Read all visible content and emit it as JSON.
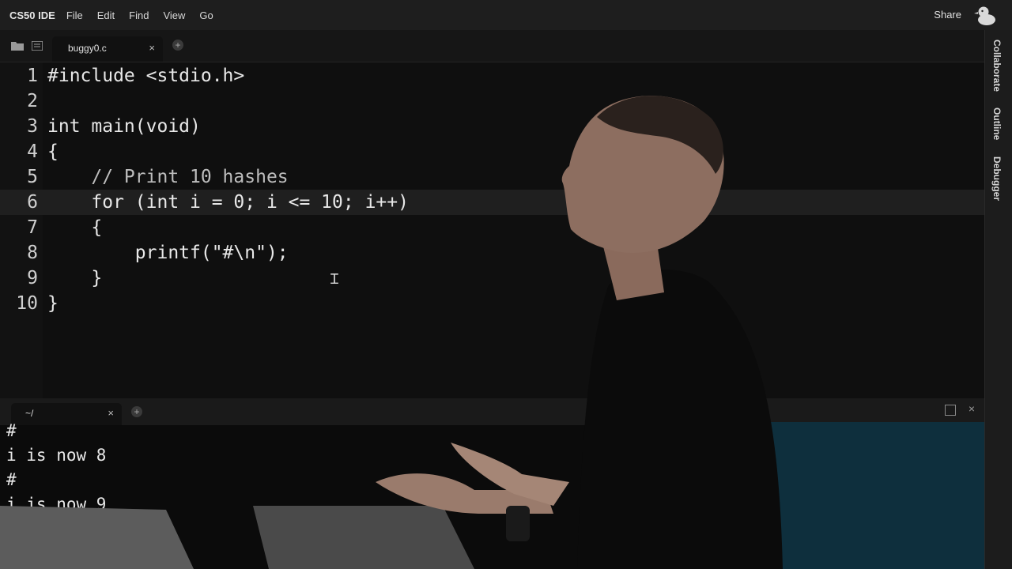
{
  "app": {
    "title": "CS50 IDE",
    "menus": [
      "File",
      "Edit",
      "Find",
      "View",
      "Go"
    ],
    "share_label": "Share"
  },
  "editor": {
    "tab": {
      "label": "buggy0.c",
      "close": "×"
    },
    "add_tab": "+",
    "active_line": 6,
    "lines": [
      {
        "num": "1",
        "text": "#include <stdio.h>"
      },
      {
        "num": "2",
        "text": ""
      },
      {
        "num": "3",
        "text": "int main(void)"
      },
      {
        "num": "4",
        "text": "{"
      },
      {
        "num": "5",
        "text": "    // Print 10 hashes"
      },
      {
        "num": "6",
        "text": "    for (int i = 0; i <= 10; i++)"
      },
      {
        "num": "7",
        "text": "    {"
      },
      {
        "num": "8",
        "text": "        printf(\"#\\n\");"
      },
      {
        "num": "9",
        "text": "    }"
      },
      {
        "num": "10",
        "text": "}"
      }
    ]
  },
  "side_panel": {
    "tabs": [
      "Collaborate",
      "Outline",
      "Debugger"
    ]
  },
  "terminal": {
    "tab": {
      "label": "~/",
      "close": "×"
    },
    "add_tab": "+",
    "close": "×",
    "lines": [
      "#",
      "i is now 8",
      "#",
      "i is now 9"
    ]
  },
  "icons": {
    "ibeam": "Ɪ"
  },
  "colors": {
    "menubar": "#1e1e1e",
    "editor_bg": "#0f0f0f",
    "active_line": "#1f1f1f",
    "terminal_bg": "#0b0b0b"
  }
}
